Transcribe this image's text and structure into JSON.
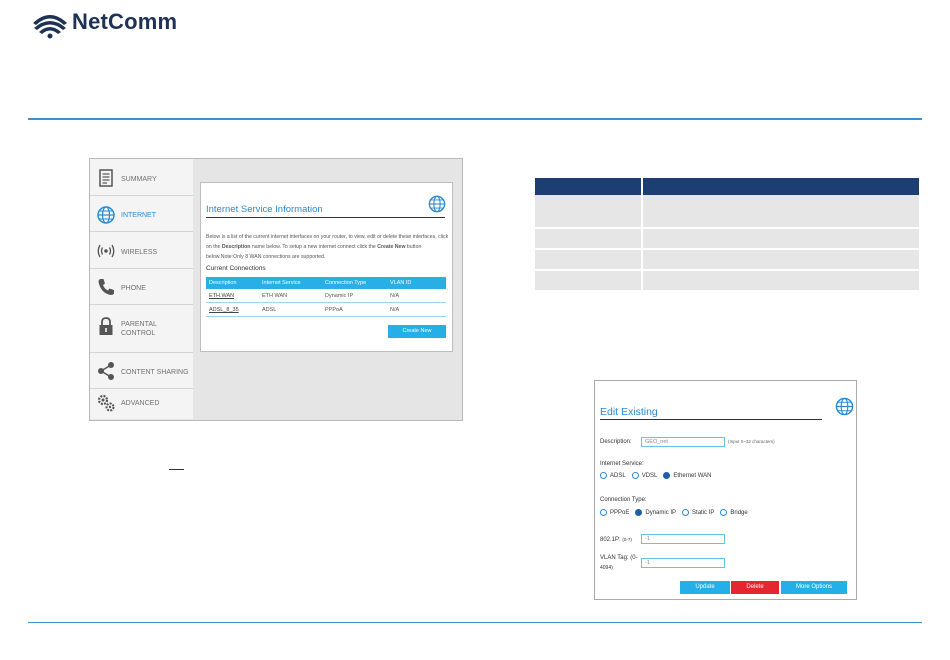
{
  "brand": {
    "name": "NetComm",
    "accent": "#3d8fc6",
    "nav_accent": "#2a8ad0",
    "table_header": "#2aaee6"
  },
  "sidebar": {
    "items": [
      {
        "label": "SUMMARY",
        "icon": "document-icon"
      },
      {
        "label": "INTERNET",
        "icon": "globe-icon",
        "active": true
      },
      {
        "label": "WIRELESS",
        "icon": "wifi-icon"
      },
      {
        "label": "PHONE",
        "icon": "phone-icon"
      },
      {
        "label": "PARENTAL",
        "label2": "CONTROL",
        "icon": "lock-icon"
      },
      {
        "label": "CONTENT SHARING",
        "icon": "share-icon"
      },
      {
        "label": "ADVANCED",
        "icon": "gears-icon"
      }
    ]
  },
  "internet_service": {
    "title": "Internet Service Information",
    "desc_1": "Below is a list of the current internet interfaces on your router, to view, edit or delete these interfaces, click on the ",
    "desc_bold_1": "Description",
    "desc_2": " name below. To setup a new internet connect click the ",
    "desc_bold_2": "Create New",
    "desc_3": " button below.Note:Only 8 WAN connections are supported.",
    "current_connections": "Current Connections",
    "columns": [
      "Description",
      "Internet Service",
      "Connection Type",
      "VLAN ID"
    ],
    "rows": [
      [
        "ETH.WAN",
        "ETH WAN",
        "Dynamic IP",
        "N/A"
      ],
      [
        "ADSL_8_35",
        "ADSL",
        "PPPoA",
        "N/A"
      ]
    ],
    "create_new": "Create New"
  },
  "edit_existing": {
    "title": "Edit Existing",
    "description_label": "Description:",
    "description_value": "GEO_net",
    "description_hint": "(Input 0~32 characters)",
    "internet_service_label": "Internet Service:",
    "internet_service_options": [
      "ADSL",
      "VDSL",
      "Ethernet WAN"
    ],
    "internet_service_selected": "Ethernet WAN",
    "connection_type_label": "Connection Type:",
    "connection_type_options": [
      "PPPoE",
      "Dynamic IP",
      "Static IP",
      "Bridge"
    ],
    "connection_type_selected": "Dynamic IP",
    "p8021_label": "802.1P:",
    "p8021_range": "(0-7)",
    "p8021_value": "-1",
    "vlan_label_1": "VLAN Tag: (0-",
    "vlan_label_2": "4094)",
    "vlan_value": "-1",
    "buttons": {
      "update": "Update",
      "delete": "Delete",
      "more": "More Options"
    },
    "button_colors": {
      "update": "#25aee7",
      "delete": "#e3262f",
      "more": "#25aee7"
    }
  }
}
